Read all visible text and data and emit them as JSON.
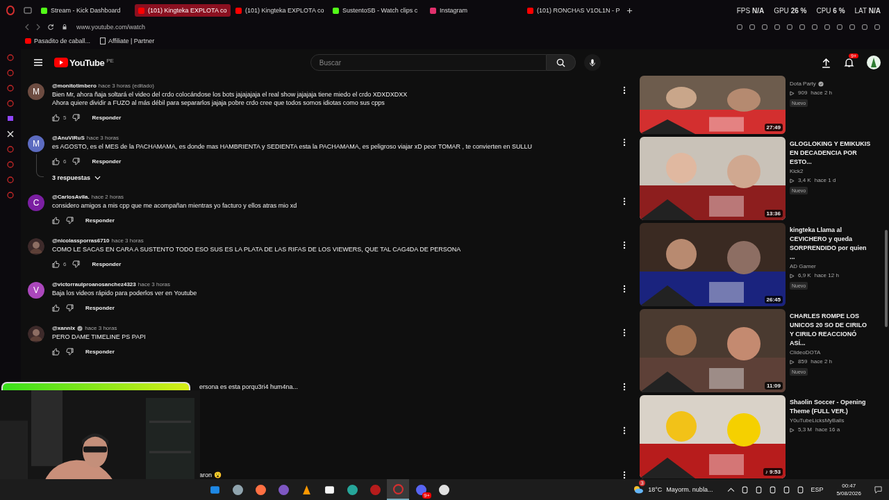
{
  "browser": {
    "tabs": [
      {
        "label": "Stream - Kick Dashboard",
        "kind": "kick",
        "selected": false
      },
      {
        "label": "(101) Kingteka EXPLOTA co",
        "kind": "youtube",
        "selected": true
      },
      {
        "label": "(101) Kingteka EXPLOTA co",
        "kind": "youtube",
        "selected": false
      },
      {
        "label": "SustentoSB - Watch clips c",
        "kind": "kick",
        "selected": false
      },
      {
        "label": "Instagram",
        "kind": "instagram",
        "selected": false
      },
      {
        "label": "(101) RONCHAS V1OL1N - P",
        "kind": "youtube",
        "selected": false
      }
    ],
    "stats": [
      {
        "label": "FPS",
        "value": "N/A"
      },
      {
        "label": "GPU",
        "value": "26 %"
      },
      {
        "label": "CPU",
        "value": "6 %"
      },
      {
        "label": "LAT",
        "value": "N/A"
      }
    ],
    "url": "www.youtube.com/watch",
    "bookmarks": [
      {
        "label": "Pasadito de caball...",
        "kind": "youtube"
      },
      {
        "label": "Affiliate | Partner",
        "kind": "page"
      }
    ]
  },
  "header": {
    "logo": "YouTube",
    "region": "PE",
    "search_placeholder": "Buscar",
    "notifications": "9+"
  },
  "comments": [
    {
      "avatar": "M",
      "color": "#6d4c41",
      "kind": "letter",
      "author": "@monitotimbero",
      "verified": false,
      "time": "hace 3 horas (editado)",
      "lines": [
        "Bien Mr, ahora ñaja soltará el video del crdo colocándose los bots jajajajaja el real show jajajaja tiene miedo el crdo  XDXDXDXX",
        "Ahora quiere dividir a FUZO  al más débil para separarlos jajaja pobre crdo cree que todos somos idiotas como sus cpps"
      ],
      "likes": "5",
      "reply": "Responder"
    },
    {
      "avatar": "M",
      "color": "#5c6bc0",
      "kind": "letter",
      "author": "@AnuViRuS",
      "verified": false,
      "time": "hace 3 horas",
      "lines": [
        "es AGOSTO, es el MES de la PACHAMAMA, es donde mas HAMBRIENTA y SEDIENTA esta la PACHAMAMA, es peligroso viajar xD peor TOMAR , te convierten en  SULLU"
      ],
      "likes": "6",
      "reply": "Responder",
      "replies": "3 respuestas"
    },
    {
      "avatar": "C",
      "color": "#7b1fa2",
      "kind": "letter",
      "author": "@CarlosAvila.",
      "verified": false,
      "time": "hace 2 horas",
      "lines": [
        "considero amigos a mis cpp que me acompañan mientras yo facturo y ellos atras mio xd"
      ],
      "reply": "Responder"
    },
    {
      "kind": "picture",
      "author": "@nicolassporras6710",
      "verified": false,
      "time": "hace 3 horas",
      "lines": [
        "COMO LE SACAS EN CARA A SUSTENTO TODO ESO SUS ES LA PLATA DE LAS RIFAS DE LOS VIEWERS, QUE TAL CAG4DA DE PERSONA"
      ],
      "likes": "6",
      "reply": "Responder"
    },
    {
      "avatar": "V",
      "color": "#ab47bc",
      "kind": "letter",
      "author": "@victorraulproanosanchez4323",
      "verified": false,
      "time": "hace 3 horas",
      "lines": [
        "Baja los videos rápido para poderlos ver en Youtube"
      ],
      "reply": "Responder"
    },
    {
      "kind": "picture",
      "author": "@xannlx",
      "verified": true,
      "time": "hace 3 horas",
      "lines": [
        "PERO DAME TIMELINE PS PAPI"
      ],
      "reply": "Responder"
    }
  ],
  "covered_fragments": [
    "ersona es esta porqu3ri4 hum4na...",
    "aron 😮"
  ],
  "related": [
    {
      "channel": "Dota Party",
      "verified": true,
      "views": "909",
      "age": "hace 2 h",
      "badge": "Nuevo",
      "duration": "27:49"
    },
    {
      "title": "GLOGLOKING Y EMIKUKIS EN DECADENCIA POR ESTO...",
      "channel": "Kick2",
      "verified": false,
      "views": "3,4 K",
      "age": "hace 1 d",
      "badge": "Nuevo",
      "duration": "13:36"
    },
    {
      "title": "kingteka Llama al CEVICHERO y queda SORPRENDIDO por quien ...",
      "channel": "AD Gamer",
      "verified": false,
      "views": "6,9 K",
      "age": "hace 12 h",
      "badge": "Nuevo",
      "duration": "26:45"
    },
    {
      "title": "CHARLES ROMPE LOS UNICOS 20 SO DE CIRILO Y CIRILO REACCIONÓ ASÍ...",
      "channel": "ClideoDOTA",
      "verified": false,
      "views": "859",
      "age": "hace 2 h",
      "badge": "Nuevo",
      "duration": "11:09"
    },
    {
      "title": "Shaolin Soccer - Opening Theme (FULL VER.)",
      "channel": "Y0uTubeLicksMyBalls",
      "verified": false,
      "views": "5,3 M",
      "age": "hace 16 a",
      "duration": "♪ 9:53"
    }
  ],
  "taskbar": {
    "apps": [
      {
        "kind": "mail"
      },
      {
        "kind": "photos"
      },
      {
        "kind": "firefox"
      },
      {
        "kind": "copilot"
      },
      {
        "kind": "vlc"
      },
      {
        "kind": "store"
      },
      {
        "kind": "edge"
      },
      {
        "kind": "dota"
      },
      {
        "kind": "opera",
        "selected": true
      },
      {
        "kind": "discord",
        "badge": "9+"
      },
      {
        "kind": "obs"
      }
    ],
    "weather": {
      "temp": "18°C",
      "text": "Mayorm. nubla...",
      "badge": "3"
    },
    "language": "ESP",
    "time": "00:47",
    "date": "5/08/2026"
  }
}
